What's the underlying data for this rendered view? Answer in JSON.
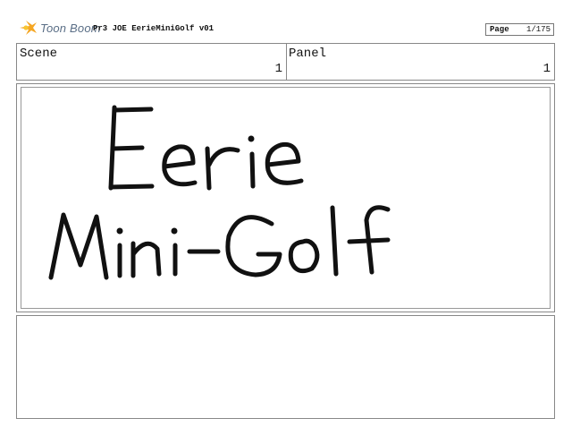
{
  "header": {
    "logo_text": "Toon Boom",
    "title": "Pr3 JOE EerieMiniGolf v01",
    "page_label": "Page",
    "page_number": "1/175"
  },
  "info": {
    "scene_label": "Scene",
    "scene_value": "1",
    "panel_label": "Panel",
    "panel_value": "1"
  },
  "panel": {
    "drawing_line1": "Eerie",
    "drawing_line2": "Mini-Golf"
  },
  "notes": {}
}
